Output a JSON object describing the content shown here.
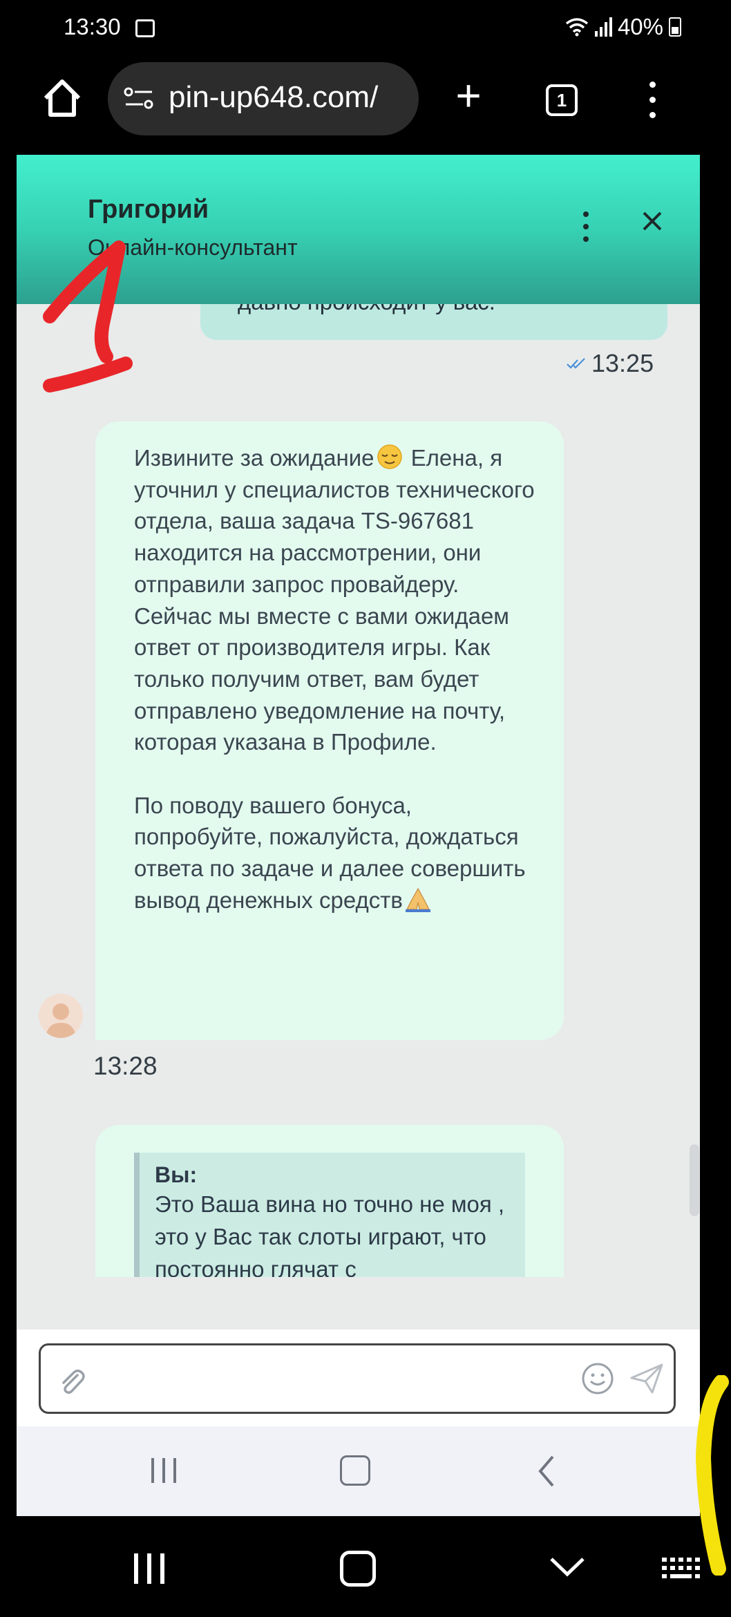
{
  "status_bar": {
    "time": "13:30",
    "battery": "40%"
  },
  "browser": {
    "url": "pin-up648.com/",
    "tab_count": "1"
  },
  "chat_header": {
    "agent_name": "Григорий",
    "agent_role": "Онлайн-консультант",
    "accent_top": "#43efcd",
    "accent_bottom": "#2da090"
  },
  "messages": {
    "user_partial_text": "давно происходит у вас.",
    "user_time": "13:25",
    "agent_paragraph_1_start": "Извините за ожидание",
    "agent_paragraph_1_rest": " Елена, я уточнил у специалистов технического отдела, ваша задача TS-967681 находится на рассмотрении, они отправили запрос провайдеру. Сейчас мы вместе с вами ожидаем ответ от производителя игры. Как только получим ответ, вам будет отправлено уведомление на почту, которая указана в Профиле.",
    "agent_paragraph_2": "По поводу вашего бонуса, попробуйте, пожалуйста, дождаться ответа по задаче и далее совершить вывод денежных средств",
    "agent_time": "13:28",
    "reply_author": "Вы",
    "reply_quote": "Это Ваша вина но точно не моя , это у Вас так слоты играют, что постоянно глячат с"
  },
  "input": {
    "placeholder": ""
  },
  "annotations": {
    "red_mark_text": "1",
    "red_color": "#e8262a",
    "yellow_color": "#f5e20c"
  }
}
